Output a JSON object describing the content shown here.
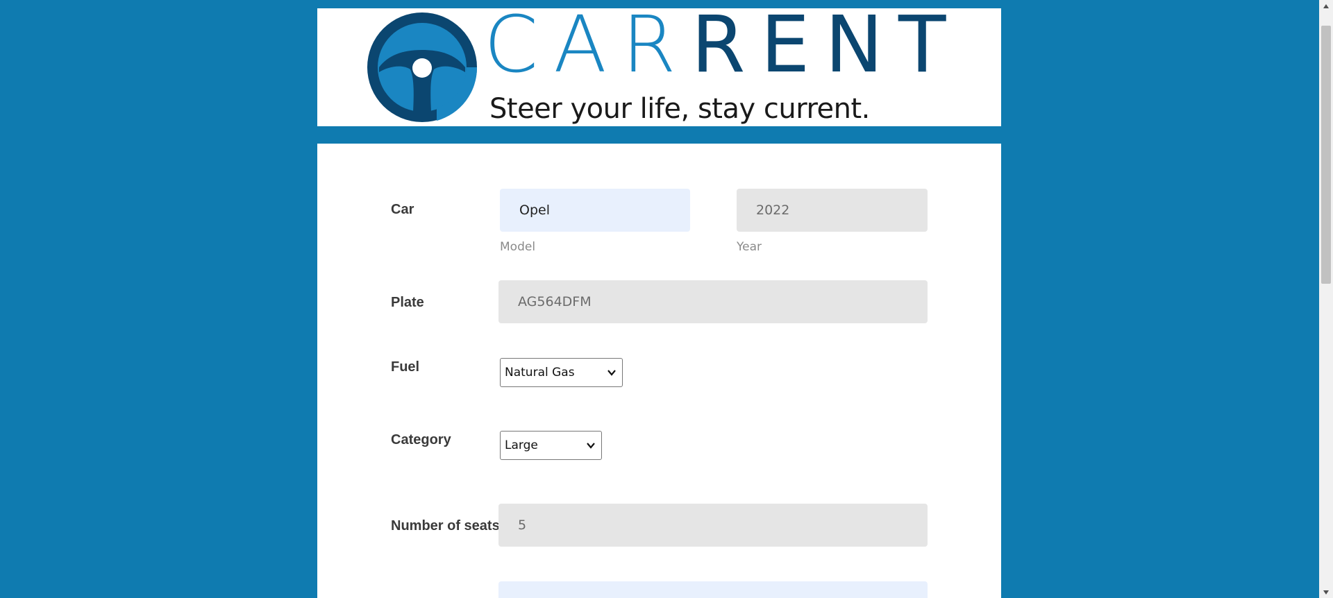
{
  "brand": {
    "logo_part1": "CAR",
    "logo_part2": "RENT",
    "tagline": "Steer your life, stay current."
  },
  "colors": {
    "page_background": "#0f7bb0",
    "logo_light_blue": "#1a86c2",
    "logo_dark_blue": "#0b4670",
    "input_editable_bg": "#e8f0fd",
    "input_readonly_bg": "#e5e5e5"
  },
  "form": {
    "car": {
      "label": "Car",
      "model_value": "Opel",
      "model_hint": "Model",
      "year_value": "2022",
      "year_hint": "Year"
    },
    "plate": {
      "label": "Plate",
      "value": "AG564DFM"
    },
    "fuel": {
      "label": "Fuel",
      "selected": "Natural Gas"
    },
    "category": {
      "label": "Category",
      "selected": "Large"
    },
    "seats": {
      "label": "Number of seats",
      "value": "5"
    }
  },
  "icons": {
    "logo": "steering-wheel-icon",
    "select_arrow": "chevron-down-icon",
    "scroll_up": "triangle-up-icon",
    "scroll_down": "triangle-down-icon"
  }
}
